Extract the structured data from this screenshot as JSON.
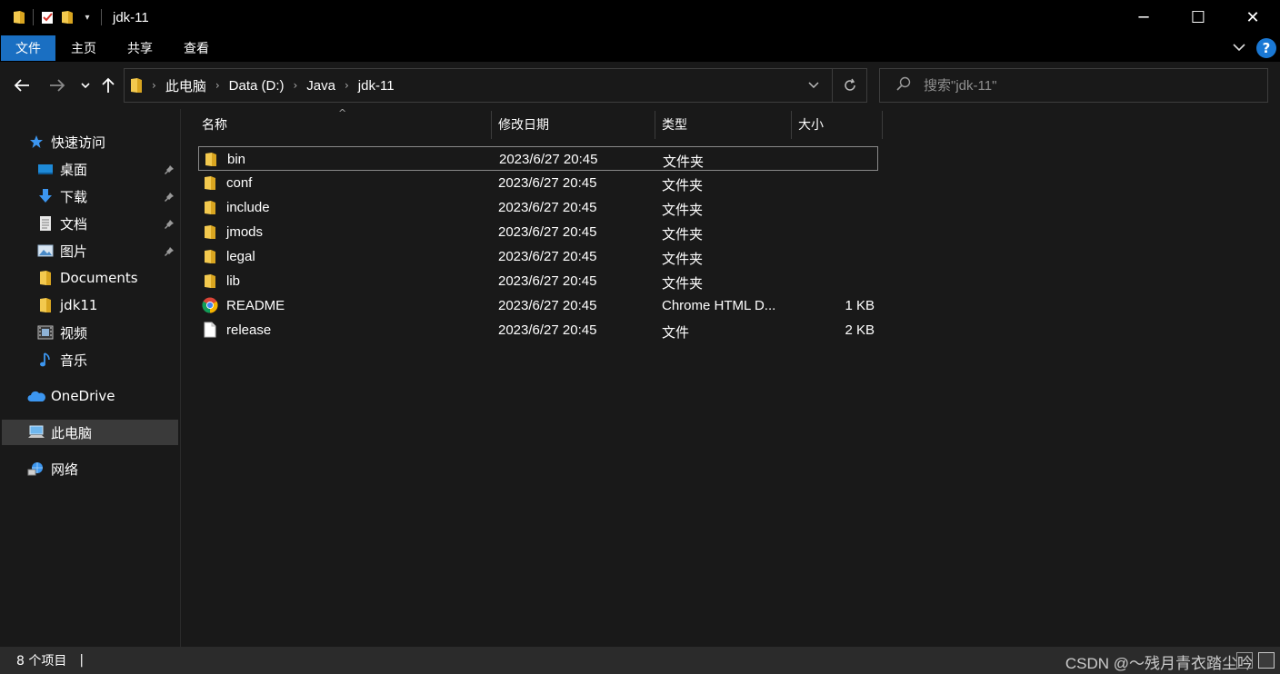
{
  "window": {
    "title": "jdk-11",
    "controls": [
      "─",
      "☐",
      "✕"
    ]
  },
  "ribbon": {
    "tabs": [
      "文件",
      "主页",
      "共享",
      "查看"
    ],
    "help_label": "?",
    "collapse_label": "⌵"
  },
  "nav": {
    "back": "←",
    "forward": "→",
    "recent": "⌄",
    "up": "↑",
    "breadcrumb": [
      "此电脑",
      "Data (D:)",
      "Java",
      "jdk-11"
    ],
    "refresh": "↻",
    "dropdown": "⌄",
    "search_placeholder": "搜索\"jdk-11\""
  },
  "sidebar": {
    "items": [
      {
        "label": "快速访问",
        "icon": "star-icon",
        "pinned": false
      },
      {
        "label": "桌面",
        "icon": "desktop-icon",
        "pinned": true
      },
      {
        "label": "下载",
        "icon": "download-icon",
        "pinned": true
      },
      {
        "label": "文档",
        "icon": "document-icon",
        "pinned": true
      },
      {
        "label": "图片",
        "icon": "picture-icon",
        "pinned": true
      },
      {
        "label": "Documents",
        "icon": "folder-icon",
        "pinned": false
      },
      {
        "label": "jdk11",
        "icon": "folder-icon",
        "pinned": false
      },
      {
        "label": "视频",
        "icon": "video-icon",
        "pinned": false
      },
      {
        "label": "音乐",
        "icon": "music-icon",
        "pinned": false
      },
      {
        "label": "OneDrive",
        "icon": "cloud-icon",
        "pinned": false
      },
      {
        "label": "此电脑",
        "icon": "computer-icon",
        "pinned": false,
        "selected": true
      },
      {
        "label": "网络",
        "icon": "network-icon",
        "pinned": false
      }
    ]
  },
  "file_list": {
    "columns": [
      "名称",
      "修改日期",
      "类型",
      "大小"
    ],
    "sort_indicator": "^",
    "rows": [
      {
        "name": "bin",
        "date": "2023/6/27 20:45",
        "type": "文件夹",
        "size": "",
        "icon": "folder-icon",
        "focused": true
      },
      {
        "name": "conf",
        "date": "2023/6/27 20:45",
        "type": "文件夹",
        "size": "",
        "icon": "folder-icon"
      },
      {
        "name": "include",
        "date": "2023/6/27 20:45",
        "type": "文件夹",
        "size": "",
        "icon": "folder-icon"
      },
      {
        "name": "jmods",
        "date": "2023/6/27 20:45",
        "type": "文件夹",
        "size": "",
        "icon": "folder-icon"
      },
      {
        "name": "legal",
        "date": "2023/6/27 20:45",
        "type": "文件夹",
        "size": "",
        "icon": "folder-icon"
      },
      {
        "name": "lib",
        "date": "2023/6/27 20:45",
        "type": "文件夹",
        "size": "",
        "icon": "folder-icon"
      },
      {
        "name": "README",
        "date": "2023/6/27 20:45",
        "type": "Chrome HTML D...",
        "size": "1 KB",
        "icon": "chrome-icon"
      },
      {
        "name": "release",
        "date": "2023/6/27 20:45",
        "type": "文件",
        "size": "2 KB",
        "icon": "file-icon"
      }
    ]
  },
  "status": {
    "count": "8 个项目",
    "separator": "|",
    "watermark": "CSDN @～残月青衣踏尘吟"
  },
  "colors": {
    "background": "#191919",
    "titlebar": "#000000",
    "accent": "#1a6fc2",
    "folder": "#f3c94e",
    "selected": "#3a3a3a"
  }
}
